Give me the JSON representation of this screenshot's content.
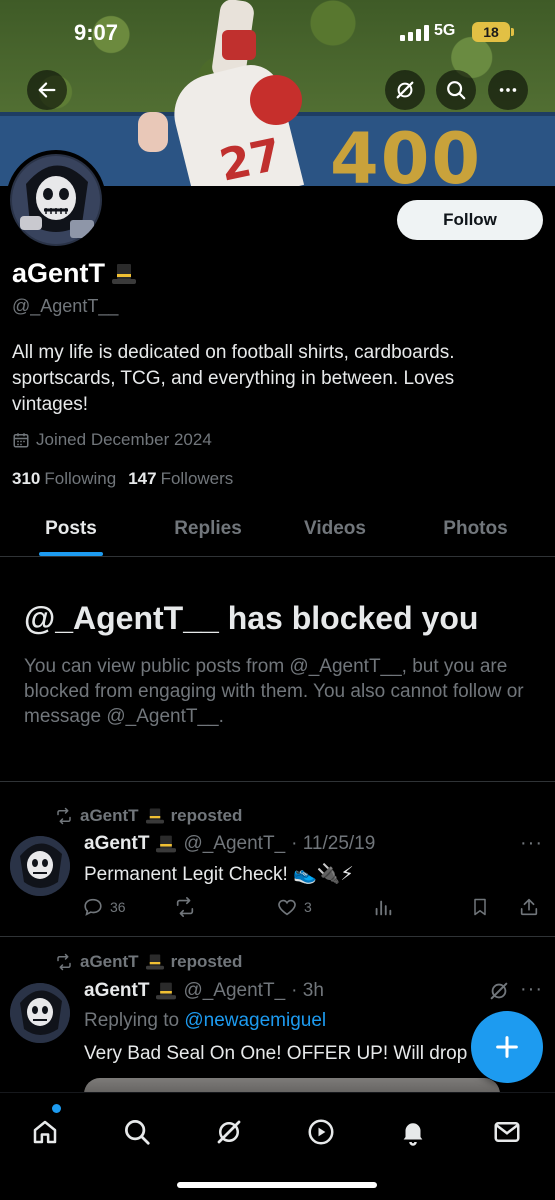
{
  "status_bar": {
    "time": "9:07",
    "network": "5G",
    "battery": "18"
  },
  "profile": {
    "display_name": "aGentT",
    "handle": "@_AgentT__",
    "follow_label": "Follow",
    "bio": "All my life is dedicated on football shirts, cardboards. sportscards, TCG, and everything in between. Loves vintages!",
    "joined": "Joined December 2024",
    "following_count": "310",
    "following_label": "Following",
    "followers_count": "147",
    "followers_label": "Followers"
  },
  "tabs": [
    {
      "label": "Posts",
      "active": true
    },
    {
      "label": "Replies",
      "active": false
    },
    {
      "label": "Videos",
      "active": false
    },
    {
      "label": "Photos",
      "active": false
    }
  ],
  "blocked": {
    "title": "@_AgentT__ has blocked you",
    "body": "You can view public posts from @_AgentT__, but you are blocked from engaging with them. You also cannot follow or message @_AgentT__."
  },
  "posts": [
    {
      "repost_label": "reposted",
      "reposter": "aGentT",
      "author": "aGentT",
      "handle": "@_AgentT_",
      "date": "· 11/25/19",
      "text": "Permanent Legit Check! 👟🔌⚡",
      "replies": "36",
      "likes": "3"
    },
    {
      "repost_label": "reposted",
      "reposter": "aGentT",
      "author": "aGentT",
      "handle": "@_AgentT_",
      "date": "· 3h",
      "replying_prefix": "Replying to",
      "replying_to": "@newagemiguel",
      "text": "Very Bad Seal On One! OFFER UP! Will drop"
    }
  ],
  "icons": {
    "back": "arrow-left-icon",
    "grok": "grok-icon",
    "search": "search-icon",
    "more": "more-icon",
    "compose": "plus-icon",
    "nav": [
      "home-icon",
      "search-icon",
      "grok-icon",
      "play-icon",
      "bell-icon",
      "mail-icon"
    ]
  },
  "colors": {
    "accent": "#1d9bf0",
    "text_secondary": "#71767b",
    "background": "#000000"
  }
}
